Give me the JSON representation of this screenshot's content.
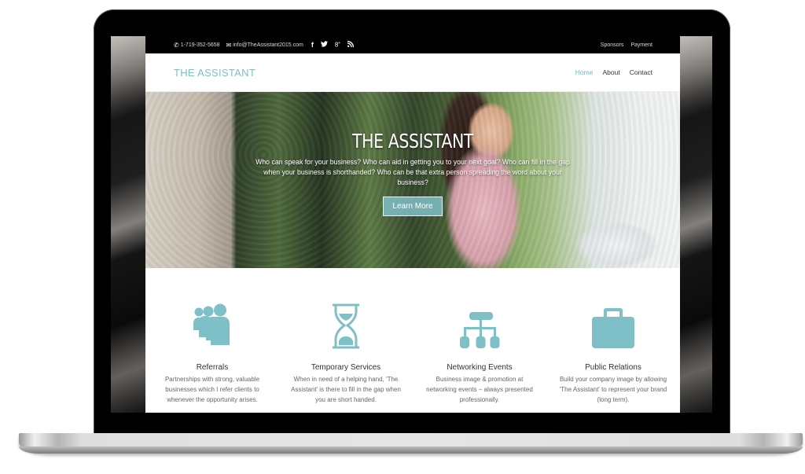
{
  "topbar": {
    "phone": "1-719-352-5658",
    "email": "info@TheAssistant2015.com",
    "social": [
      {
        "icon": "facebook-icon",
        "glyph": "f"
      },
      {
        "icon": "twitter-icon",
        "glyph": "🐦"
      },
      {
        "icon": "google-plus-icon",
        "glyph": "8⁺"
      },
      {
        "icon": "rss-icon",
        "glyph": "⌔"
      }
    ],
    "links": [
      "Sponsors",
      "Payment"
    ]
  },
  "header": {
    "logo": "THE ASSISTANT",
    "nav": [
      {
        "label": "Home",
        "active": true
      },
      {
        "label": "About",
        "active": false
      },
      {
        "label": "Contact",
        "active": false
      }
    ]
  },
  "hero": {
    "title": "THE ASSISTANT",
    "text": "Who can speak for your business? Who can aid in getting you to your next goal? Who can fill in the gap when your business is shorthanded? Who can be that extra person spreading the word about your business?",
    "button": "Learn More"
  },
  "services": [
    {
      "icon": "people-icon",
      "title": "Referrals",
      "text": "Partnerships with strong, valuable businesses which I refer clients to whenever the opportunity arises."
    },
    {
      "icon": "hourglass-icon",
      "title": "Temporary Services",
      "text": "When in need of a helping hand, 'The Assistant' is there to fill in the gap when you are short handed."
    },
    {
      "icon": "sitemap-icon",
      "title": "Networking Events",
      "text": "Business image & promotion at networking events – always presented professionally."
    },
    {
      "icon": "briefcase-icon",
      "title": "Public Relations",
      "text": "Build your company image by allowing 'The Assistant' to represent your brand (long term)."
    }
  ],
  "colors": {
    "accent": "#7fbfc7",
    "topbar_bg": "#000000",
    "text": "#333333",
    "muted_text": "#666666"
  }
}
